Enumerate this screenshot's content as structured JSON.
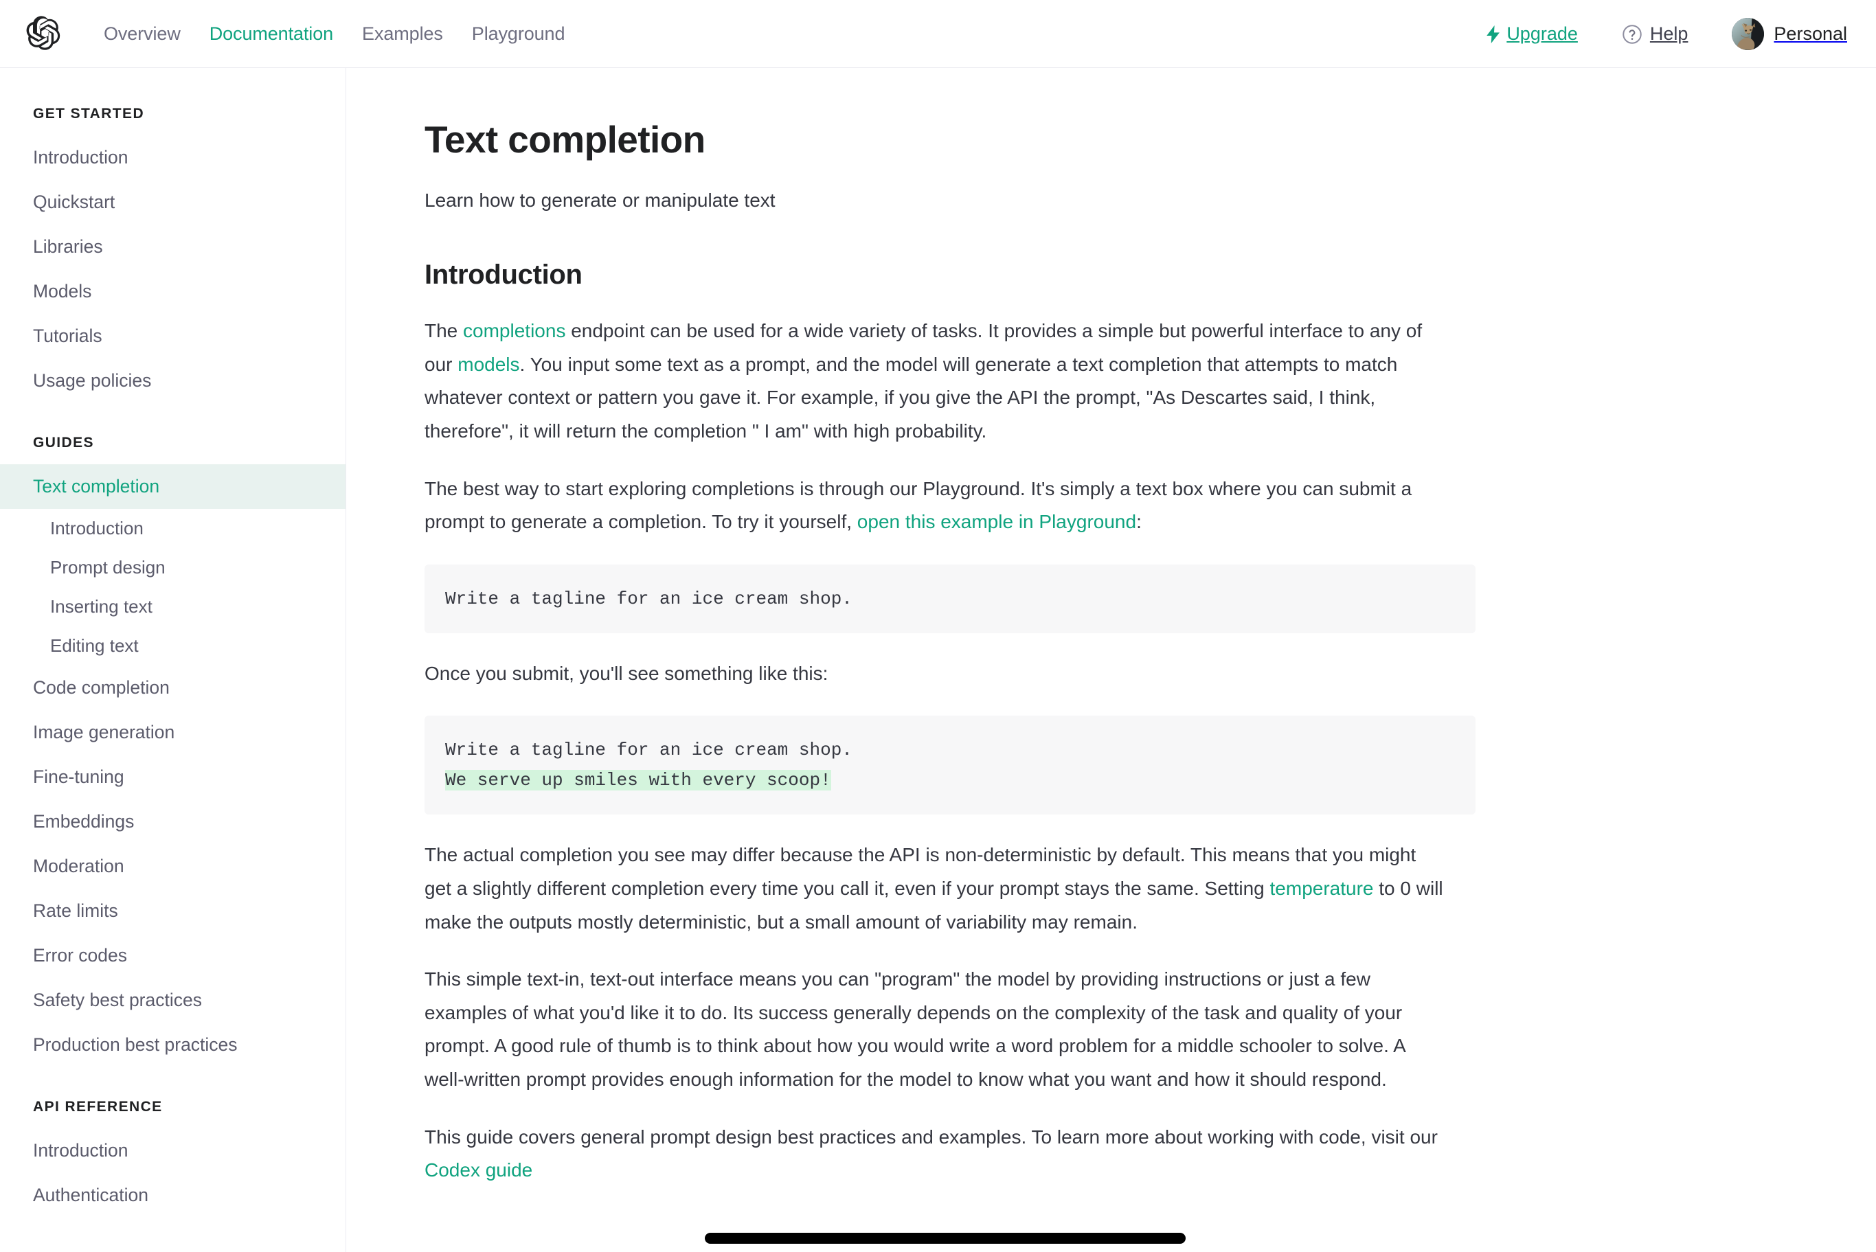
{
  "header": {
    "logo_icon": "openai-logo-icon",
    "nav": [
      {
        "label": "Overview",
        "active": false
      },
      {
        "label": "Documentation",
        "active": true
      },
      {
        "label": "Examples",
        "active": false
      },
      {
        "label": "Playground",
        "active": false
      }
    ],
    "upgrade_label": "Upgrade",
    "upgrade_icon": "bolt-icon",
    "help_label": "Help",
    "help_icon": "question-circle-icon",
    "account_label": "Personal",
    "avatar_icon": "cat-avatar-image",
    "accent_color": "#10a37f",
    "muted_text_color": "#6e6e80"
  },
  "sidebar": {
    "sections": [
      {
        "title": "GET STARTED",
        "items": [
          {
            "label": "Introduction",
            "active": false,
            "sub": false
          },
          {
            "label": "Quickstart",
            "active": false,
            "sub": false
          },
          {
            "label": "Libraries",
            "active": false,
            "sub": false
          },
          {
            "label": "Models",
            "active": false,
            "sub": false
          },
          {
            "label": "Tutorials",
            "active": false,
            "sub": false
          },
          {
            "label": "Usage policies",
            "active": false,
            "sub": false
          }
        ]
      },
      {
        "title": "GUIDES",
        "items": [
          {
            "label": "Text completion",
            "active": true,
            "sub": false
          },
          {
            "label": "Introduction",
            "active": false,
            "sub": true
          },
          {
            "label": "Prompt design",
            "active": false,
            "sub": true
          },
          {
            "label": "Inserting text",
            "active": false,
            "sub": true
          },
          {
            "label": "Editing text",
            "active": false,
            "sub": true
          },
          {
            "label": "Code completion",
            "active": false,
            "sub": false
          },
          {
            "label": "Image generation",
            "active": false,
            "sub": false
          },
          {
            "label": "Fine-tuning",
            "active": false,
            "sub": false
          },
          {
            "label": "Embeddings",
            "active": false,
            "sub": false
          },
          {
            "label": "Moderation",
            "active": false,
            "sub": false
          },
          {
            "label": "Rate limits",
            "active": false,
            "sub": false
          },
          {
            "label": "Error codes",
            "active": false,
            "sub": false
          },
          {
            "label": "Safety best practices",
            "active": false,
            "sub": false
          },
          {
            "label": "Production best practices",
            "active": false,
            "sub": false
          }
        ]
      },
      {
        "title": "API REFERENCE",
        "items": [
          {
            "label": "Introduction",
            "active": false,
            "sub": false
          },
          {
            "label": "Authentication",
            "active": false,
            "sub": false
          }
        ]
      }
    ],
    "active_highlight_color": "#e8f2ef",
    "active_text_color": "#10a37f"
  },
  "main": {
    "page_title": "Text completion",
    "subtitle": "Learn how to generate or manipulate text",
    "section_heading": "Introduction",
    "paragraph_1": {
      "part_1": "The ",
      "link_1": "completions",
      "part_2": " endpoint can be used for a wide variety of tasks. It provides a simple but powerful interface to any of our ",
      "link_2": "models",
      "part_3": ". You input some text as a prompt, and the model will generate a text completion that attempts to match whatever context or pattern you gave it. For example, if you give the API the prompt, \"As Descartes said, I think, therefore\", it will return the completion \" I am\" with high probability."
    },
    "paragraph_2": {
      "part_1": "The best way to start exploring completions is through our Playground. It's simply a text box where you can submit a prompt to generate a completion. To try it yourself, ",
      "link_1": "open this example in Playground",
      "part_2": ":"
    },
    "code_block_1": "Write a tagline for an ice cream shop.",
    "paragraph_3": "Once you submit, you'll see something like this:",
    "code_block_2": {
      "prompt_line": "Write a tagline for an ice cream shop.",
      "completion_line": "We serve up smiles with every scoop!",
      "completion_highlight_color": "#d4f4dd"
    },
    "paragraph_4": {
      "part_1": "The actual completion you see may differ because the API is non-deterministic by default. This means that you might get a slightly different completion every time you call it, even if your prompt stays the same. Setting ",
      "link_1": "temperature",
      "part_2": " to 0 will make the outputs mostly deterministic, but a small amount of variability may remain."
    },
    "paragraph_5": "This simple text-in, text-out interface means you can \"program\" the model by providing instructions or just a few examples of what you'd like it to do. Its success generally depends on the complexity of the task and quality of your prompt. A good rule of thumb is to think about how you would write a word problem for a middle schooler to solve. A well-written prompt provides enough information for the model to know what you want and how it should respond.",
    "paragraph_6": {
      "part_1": "This guide covers general prompt design best practices and examples. To learn more about working with code, visit our ",
      "link_1": "Codex guide"
    },
    "annotation": {
      "type": "drawn-underline-bar",
      "color": "#000000"
    }
  }
}
